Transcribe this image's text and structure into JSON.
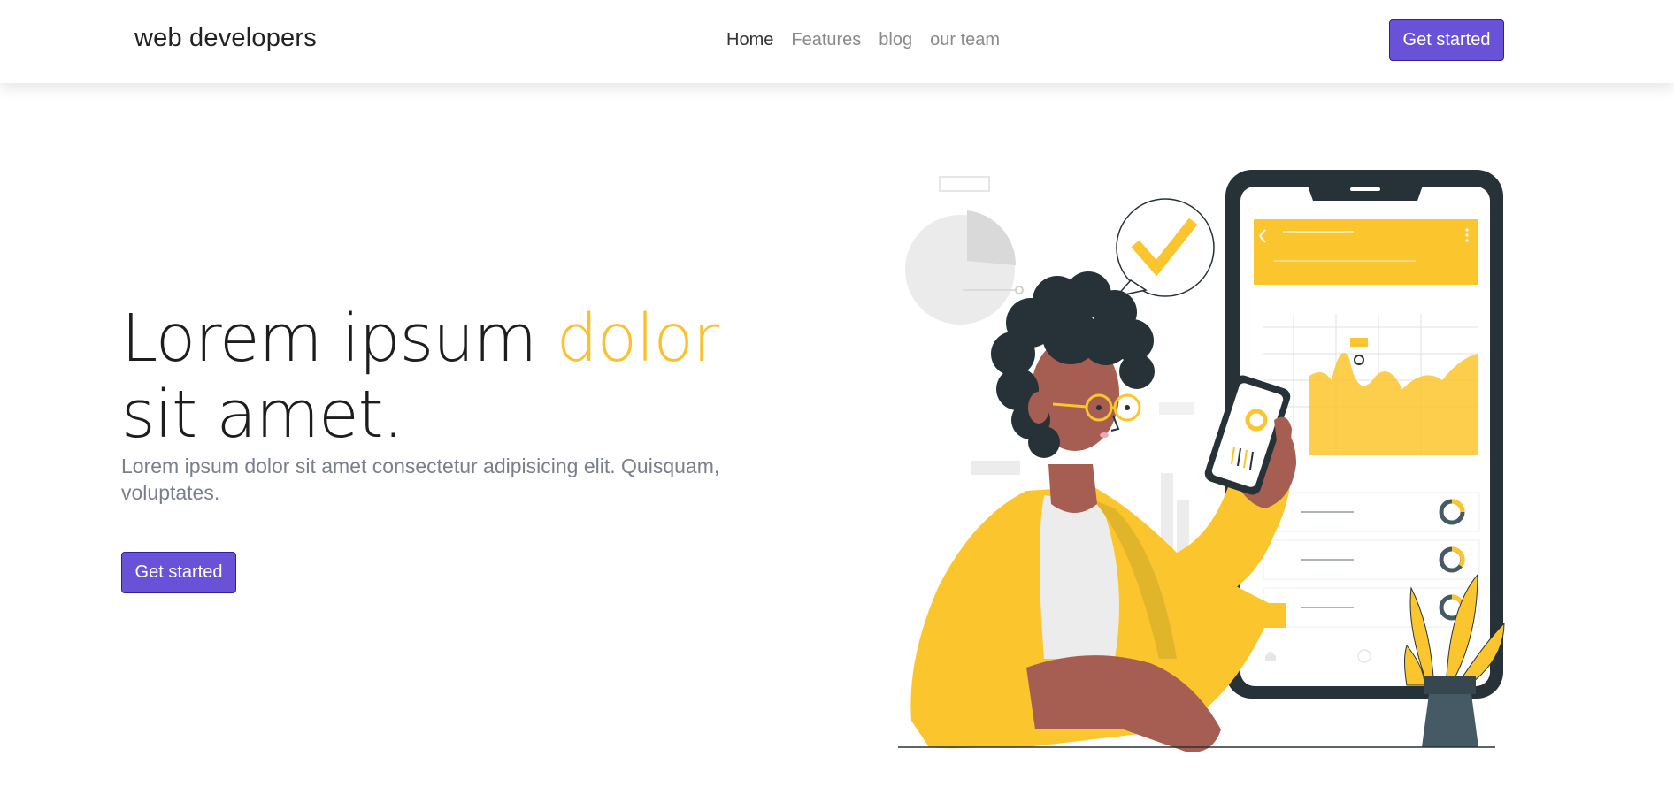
{
  "nav": {
    "brand": "web developers",
    "links": [
      {
        "label": "Home",
        "active": true
      },
      {
        "label": "Features",
        "active": false
      },
      {
        "label": "blog",
        "active": false
      },
      {
        "label": "our team",
        "active": false
      }
    ],
    "cta_label": "Get started"
  },
  "hero": {
    "title_part1": "Lorem ipsum ",
    "title_accent": "dolor",
    "title_part2": " sit amet.",
    "subtitle": "Lorem ipsum dolor sit amet consectetur adipisicing elit. Quisquam, voluptates.",
    "cta_label": "Get started"
  },
  "colors": {
    "accent": "#fbc02d",
    "primary_button": "#6a52d8",
    "phone_frame": "#263238",
    "skin": "#a65e52"
  },
  "illustration": {
    "icons": [
      "checkmark-icon",
      "pie-chart-icon",
      "donut-chart-icon",
      "home-icon",
      "back-arrow-icon",
      "more-icon"
    ]
  }
}
